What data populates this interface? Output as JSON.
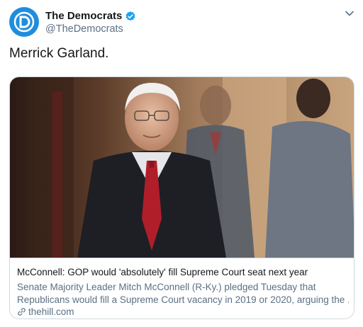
{
  "author": {
    "display_name": "The Democrats",
    "handle": "@TheDemocrats",
    "avatar_letter": "D",
    "avatar_color": "#1f8dde",
    "verified": true,
    "verified_color": "#1da1f2"
  },
  "tweet": {
    "text": "Merrick Garland."
  },
  "card": {
    "title": "McConnell: GOP would 'absolutely' fill Supreme Court seat next year",
    "description_line1": "Senate Majority Leader Mitch McConnell (R-Ky.) pledged Tuesday that",
    "description_line2": "Republicans would fill a Supreme Court vacancy in 2019 or 2020, arguing the ...",
    "domain": "thehill.com",
    "domain_icon": "link-icon"
  },
  "colors": {
    "text_primary": "#14171a",
    "text_secondary": "#5b7083",
    "border": "#cfd9de"
  }
}
